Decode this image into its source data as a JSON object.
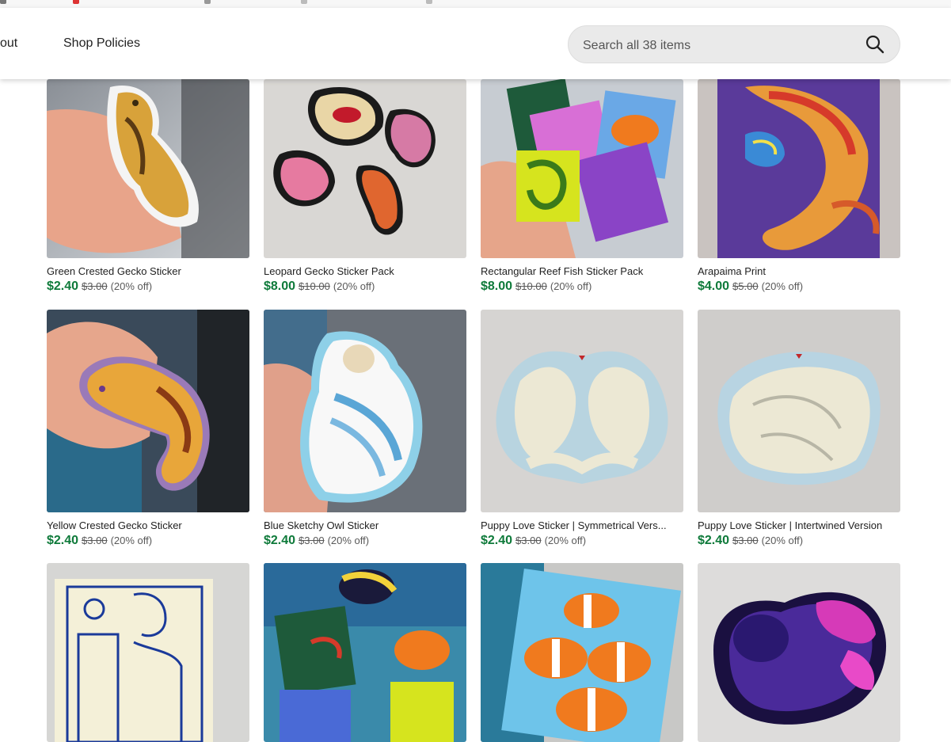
{
  "nav": {
    "about_label": "out",
    "policies_label": "Shop Policies",
    "search_placeholder": "Search all 38 items"
  },
  "items": [
    {
      "title": "Green Crested Gecko Sticker",
      "sale": "$2.40",
      "original": "$3.00",
      "discount": "(20% off)"
    },
    {
      "title": "Leopard Gecko Sticker Pack",
      "sale": "$8.00",
      "original": "$10.00",
      "discount": "(20% off)"
    },
    {
      "title": "Rectangular Reef Fish Sticker Pack",
      "sale": "$8.00",
      "original": "$10.00",
      "discount": "(20% off)"
    },
    {
      "title": "Arapaima Print",
      "sale": "$4.00",
      "original": "$5.00",
      "discount": "(20% off)"
    },
    {
      "title": "Yellow Crested Gecko Sticker",
      "sale": "$2.40",
      "original": "$3.00",
      "discount": "(20% off)"
    },
    {
      "title": "Blue Sketchy Owl Sticker",
      "sale": "$2.40",
      "original": "$3.00",
      "discount": "(20% off)"
    },
    {
      "title": "Puppy Love Sticker | Symmetrical Vers...",
      "sale": "$2.40",
      "original": "$3.00",
      "discount": "(20% off)"
    },
    {
      "title": "Puppy Love Sticker | Intertwined Version",
      "sale": "$2.40",
      "original": "$3.00",
      "discount": "(20% off)"
    },
    {
      "title": "",
      "sale": "",
      "original": "",
      "discount": ""
    },
    {
      "title": "",
      "sale": "",
      "original": "",
      "discount": ""
    },
    {
      "title": "",
      "sale": "",
      "original": "",
      "discount": ""
    },
    {
      "title": "",
      "sale": "",
      "original": "",
      "discount": ""
    }
  ],
  "colors": {
    "sale_green": "#0e7a3a",
    "nav_bg": "#ffffff",
    "search_bg": "#eaeaea"
  }
}
